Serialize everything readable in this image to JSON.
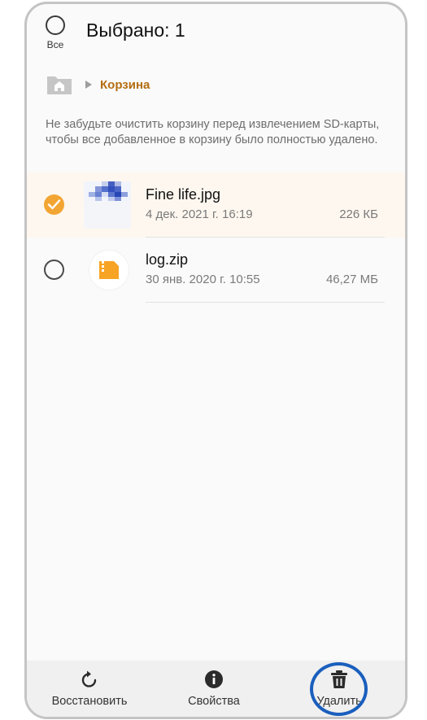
{
  "header": {
    "select_all_label": "Все",
    "title": "Выбрано: 1"
  },
  "breadcrumb": {
    "home_icon": "home-folder-icon",
    "current": "Корзина"
  },
  "notice": "Не забудьте очистить корзину перед извлечением SD-карты, чтобы все добавленное в корзину было полностью удалено.",
  "files": [
    {
      "name": "Fine life.jpg",
      "date": "4 дек. 2021 г. 16:19",
      "size": "226 КБ",
      "selected": true,
      "icon": "image-thumbnail"
    },
    {
      "name": "log.zip",
      "date": "30 янв. 2020 г. 10:55",
      "size": "46,27 МБ",
      "selected": false,
      "icon": "zip-file-icon"
    }
  ],
  "actions": {
    "restore": "Восстановить",
    "properties": "Свойства",
    "delete": "Удалить"
  },
  "colors": {
    "accent": "#f3a533",
    "breadcrumb": "#b46d10",
    "highlight": "#1a5fbd"
  }
}
